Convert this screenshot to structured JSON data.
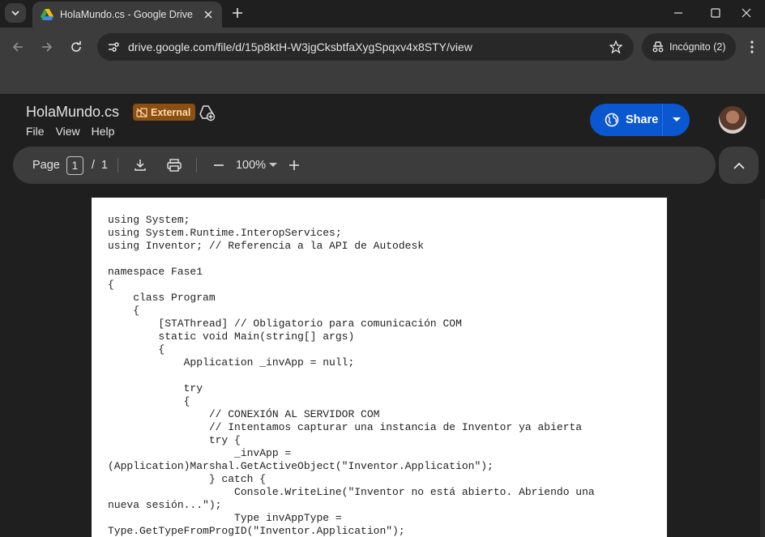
{
  "browser": {
    "tab_title": "HolaMundo.cs - Google Drive",
    "url": "drive.google.com/file/d/15p8ktH-W3jgCksbtfaXygSpqxv4x8STY/view",
    "incognito_label": "Incógnito (2)",
    "icons": [
      "tab-search-icon",
      "drive-icon",
      "close-icon",
      "plus-icon",
      "minimize-icon",
      "maximize-icon",
      "window-close-icon",
      "back-icon",
      "forward-icon",
      "reload-icon",
      "site-info-icon",
      "star-icon",
      "incognito-icon",
      "more-vert-icon"
    ]
  },
  "viewer": {
    "file_name": "HolaMundo.cs",
    "external_label": "External",
    "menu": [
      "File",
      "View",
      "Help"
    ],
    "share_label": "Share",
    "share_color": "#0b57d0",
    "page_label": "Page",
    "page_current": "1",
    "page_separator": "/",
    "page_total": "1",
    "zoom": "100%"
  },
  "document": {
    "lines": [
      "using System;",
      "using System.Runtime.InteropServices;",
      "using Inventor; // Referencia a la API de Autodesk",
      "",
      "namespace Fase1",
      "{",
      "    class Program",
      "    {",
      "        [STAThread] // Obligatorio para comunicación COM",
      "        static void Main(string[] args)",
      "        {",
      "            Application _invApp = null;",
      "",
      "            try",
      "            {",
      "                // CONEXIÓN AL SERVIDOR COM",
      "                // Intentamos capturar una instancia de Inventor ya abierta",
      "                try {",
      "                    _invApp =",
      "(Application)Marshal.GetActiveObject(\"Inventor.Application\");",
      "                } catch {",
      "                    Console.WriteLine(\"Inventor no está abierto. Abriendo una",
      "nueva sesión...\");",
      "                    Type invAppType =",
      "Type.GetTypeFromProgID(\"Inventor.Application\");"
    ]
  }
}
